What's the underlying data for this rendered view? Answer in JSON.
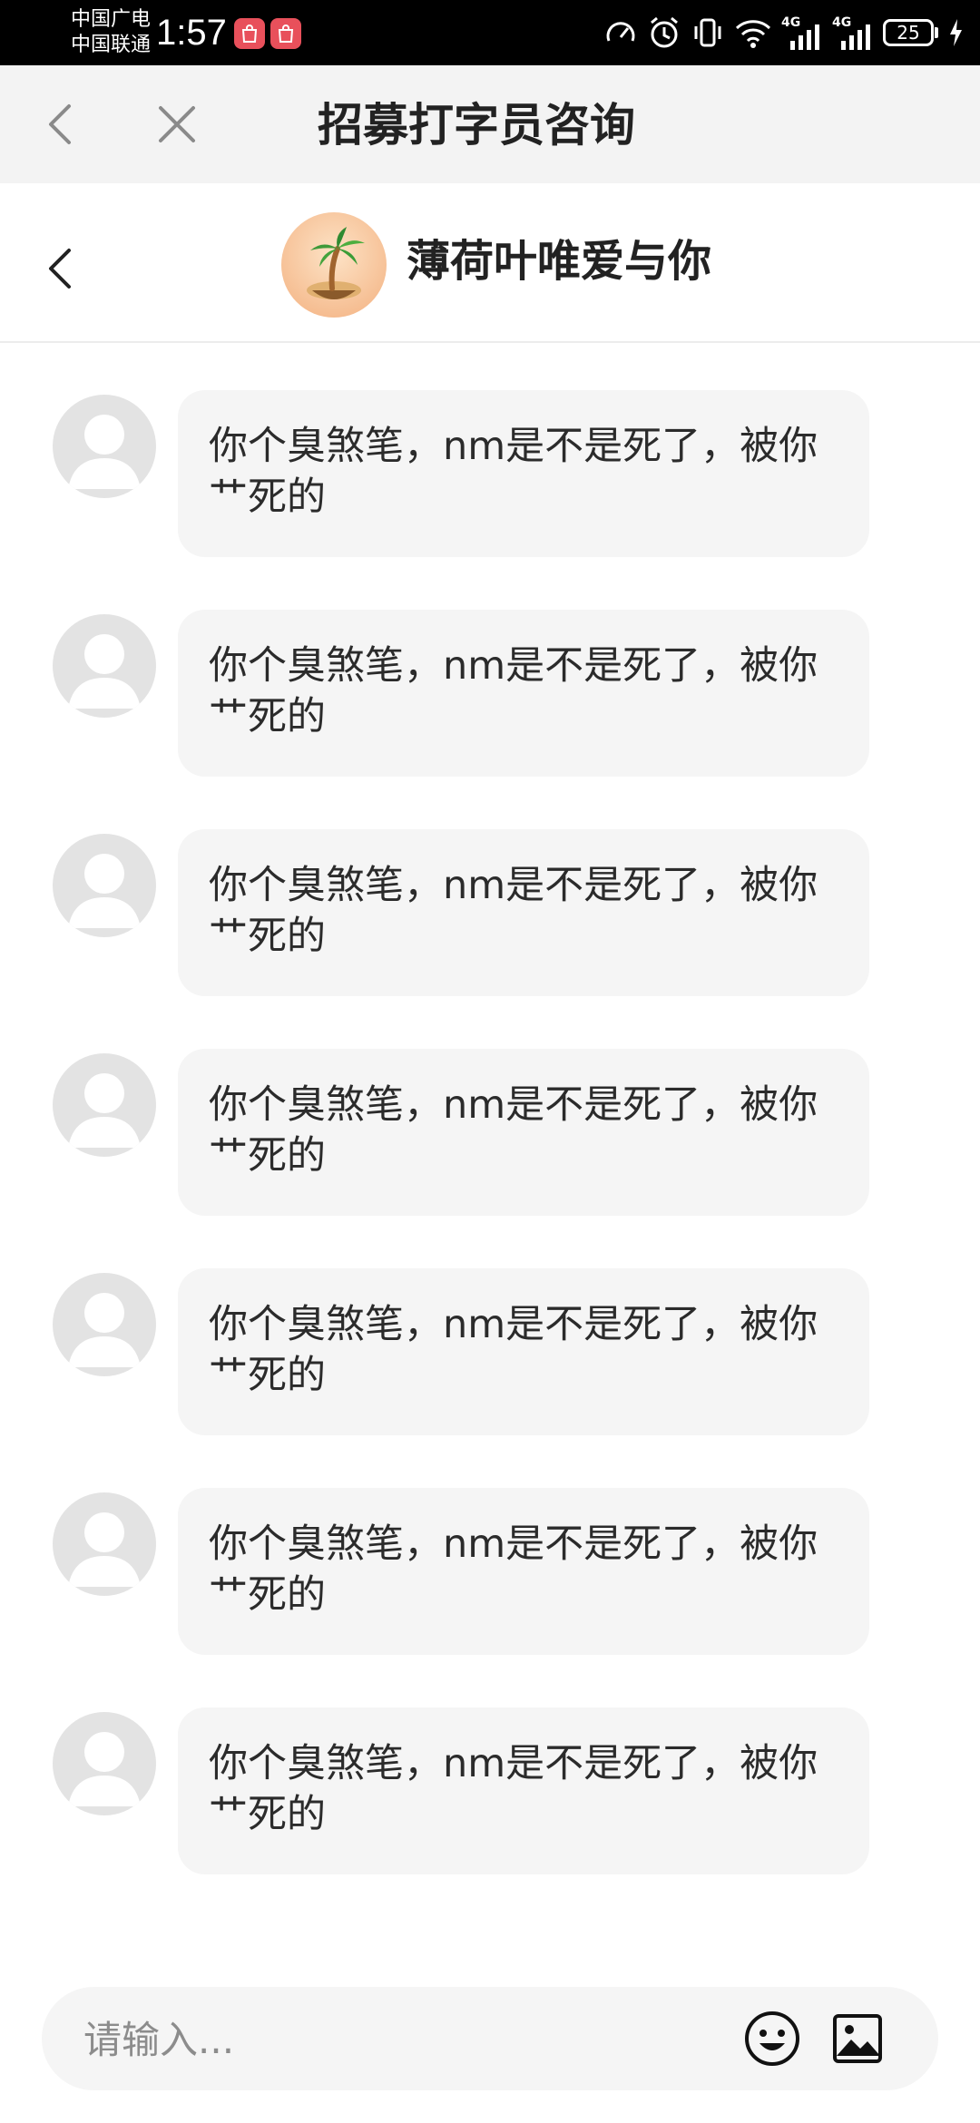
{
  "status_bar": {
    "carrier_1": "中国广电",
    "carrier_2": "中国联通",
    "time": "1:57",
    "network_1": "4G",
    "network_2": "4G",
    "battery": "25"
  },
  "nav": {
    "title": "招募打字员咨询",
    "icons": [
      "back-arrow-icon",
      "close-icon"
    ]
  },
  "chat_header": {
    "contact_name": "薄荷叶唯爱与你",
    "avatar_icon": "palm-tree-island-icon"
  },
  "messages": [
    {
      "text": "你个臭煞笔，nm是不是死了，被你艹死的"
    },
    {
      "text": "你个臭煞笔，nm是不是死了，被你艹死的"
    },
    {
      "text": "你个臭煞笔，nm是不是死了，被你艹死的"
    },
    {
      "text": "你个臭煞笔，nm是不是死了，被你艹死的"
    },
    {
      "text": "你个臭煞笔，nm是不是死了，被你艹死的"
    },
    {
      "text": "你个臭煞笔，nm是不是死了，被你艹死的"
    },
    {
      "text": "你个臭煞笔，nm是不是死了，被你艹死的"
    }
  ],
  "input": {
    "placeholder": "请输入...",
    "value": ""
  },
  "colors": {
    "status_bar_bg": "#000000",
    "nav_bg": "#f3f3f3",
    "bubble_bg": "#f5f5f5",
    "avatar_placeholder": "#e3e3e3"
  }
}
